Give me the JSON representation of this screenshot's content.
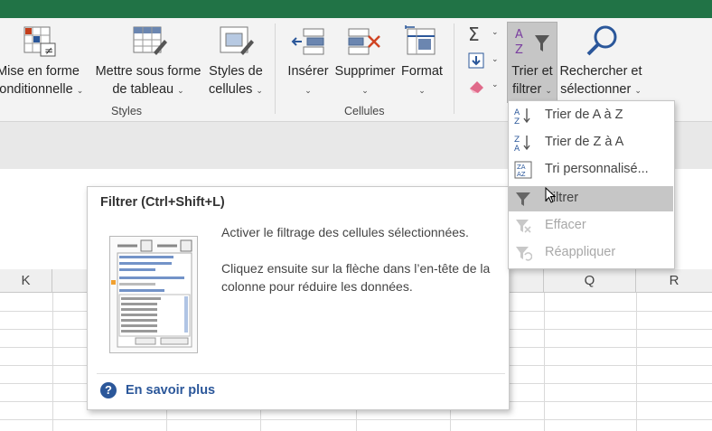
{
  "ribbon": {
    "styles_group": {
      "label": "Styles",
      "cond_format": [
        "Mise en forme",
        "conditionnelle"
      ],
      "format_table": [
        "Mettre sous forme",
        "de tableau"
      ],
      "cell_styles": [
        "Styles de",
        "cellules"
      ]
    },
    "cells_group": {
      "label": "Cellules",
      "insert": "Insérer",
      "delete": "Supprimer",
      "format": "Format"
    },
    "editing": {
      "sort_filter": [
        "Trier et",
        "filtrer"
      ],
      "find_select": [
        "Rechercher et",
        "sélectionner"
      ]
    }
  },
  "sort_menu": {
    "items": [
      {
        "label": "Trier de A à Z",
        "icon": "sort-az-icon",
        "state": "enabled"
      },
      {
        "label": "Trier de Z à A",
        "icon": "sort-za-icon",
        "state": "enabled"
      },
      {
        "label": "Tri personnalisé...",
        "icon": "custom-sort-icon",
        "state": "enabled"
      },
      {
        "label": "Filtrer",
        "icon": "filter-icon",
        "state": "highlighted"
      },
      {
        "label": "Effacer",
        "icon": "clear-filter-icon",
        "state": "disabled"
      },
      {
        "label": "Réappliquer",
        "icon": "reapply-icon",
        "state": "disabled"
      }
    ]
  },
  "tooltip": {
    "title": "Filtrer (Ctrl+Shift+L)",
    "desc1": "Activer le filtrage des cellules sélectionnées.",
    "desc2": "Cliquez ensuite sur la flèche dans l’en-tête de la colonne pour réduire les données.",
    "help": "En savoir plus"
  },
  "columns": [
    "K",
    "Q",
    "R"
  ],
  "colors": {
    "excel_green": "#217346",
    "highlight": "#c6c6c6",
    "link_blue": "#2b579a",
    "sort_purple": "#7b3fa0"
  }
}
